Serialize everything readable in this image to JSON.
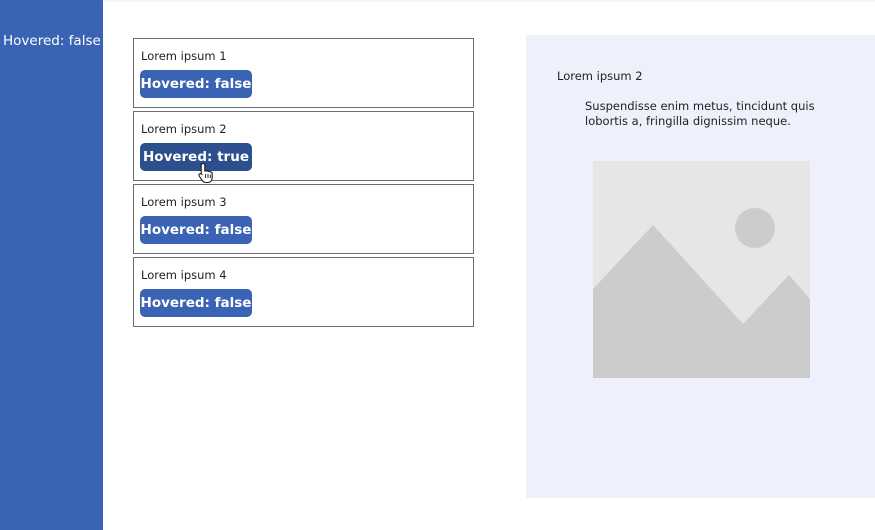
{
  "sidebar": {
    "status_label": "Hovered: false",
    "background_color": "#3a63b4"
  },
  "gallery": {
    "items": [
      {
        "title": "Lorem ipsum 1",
        "button_label": "Hovered: false",
        "hovered": false
      },
      {
        "title": "Lorem ipsum 2",
        "button_label": "Hovered: true",
        "hovered": true
      },
      {
        "title": "Lorem ipsum 3",
        "button_label": "Hovered: false",
        "hovered": false
      },
      {
        "title": "Lorem ipsum 4",
        "button_label": "Hovered: false",
        "hovered": false
      }
    ]
  },
  "detail": {
    "title": "Lorem ipsum 2",
    "body": "Suspendisse enim metus, tincidunt quis lobortis a, fringilla dignissim neque.",
    "image_icon": "image-placeholder-icon"
  },
  "colors": {
    "accent": "#3a63b4",
    "button_hovered": "#2c4f8e",
    "panel_background": "#eef1fb"
  }
}
